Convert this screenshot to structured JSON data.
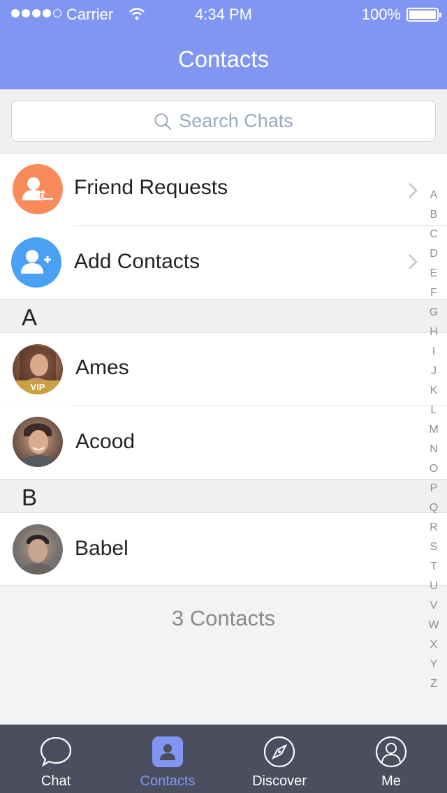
{
  "status_bar": {
    "carrier": "Carrier",
    "time": "4:34 PM",
    "battery": "100%"
  },
  "header": {
    "title": "Contacts"
  },
  "search": {
    "placeholder": "Search Chats"
  },
  "actions": [
    {
      "label": "Friend Requests",
      "icon": "friend-request-icon",
      "color": "#f98a5a"
    },
    {
      "label": "Add Contacts",
      "icon": "add-contact-icon",
      "color": "#4aa0f3"
    }
  ],
  "sections": [
    {
      "letter": "A",
      "contacts": [
        {
          "name": "Ames",
          "badge": "VIP"
        },
        {
          "name": "Acood"
        }
      ]
    },
    {
      "letter": "B",
      "contacts": [
        {
          "name": "Babel"
        }
      ]
    }
  ],
  "contact_count": "3 Contacts",
  "index_letters": [
    "A",
    "B",
    "C",
    "D",
    "E",
    "F",
    "G",
    "H",
    "I",
    "J",
    "K",
    "L",
    "M",
    "N",
    "O",
    "P",
    "Q",
    "R",
    "S",
    "T",
    "U",
    "V",
    "W",
    "X",
    "Y",
    "Z"
  ],
  "tabs": [
    {
      "label": "Chat",
      "icon": "chat-bubble-icon",
      "active": false
    },
    {
      "label": "Contacts",
      "icon": "contacts-icon",
      "active": true
    },
    {
      "label": "Discover",
      "icon": "compass-icon",
      "active": false
    },
    {
      "label": "Me",
      "icon": "person-icon",
      "active": false
    }
  ],
  "colors": {
    "header": "#8196f3",
    "tabbar": "#4b4e5f",
    "active_tab": "#8196f3"
  }
}
